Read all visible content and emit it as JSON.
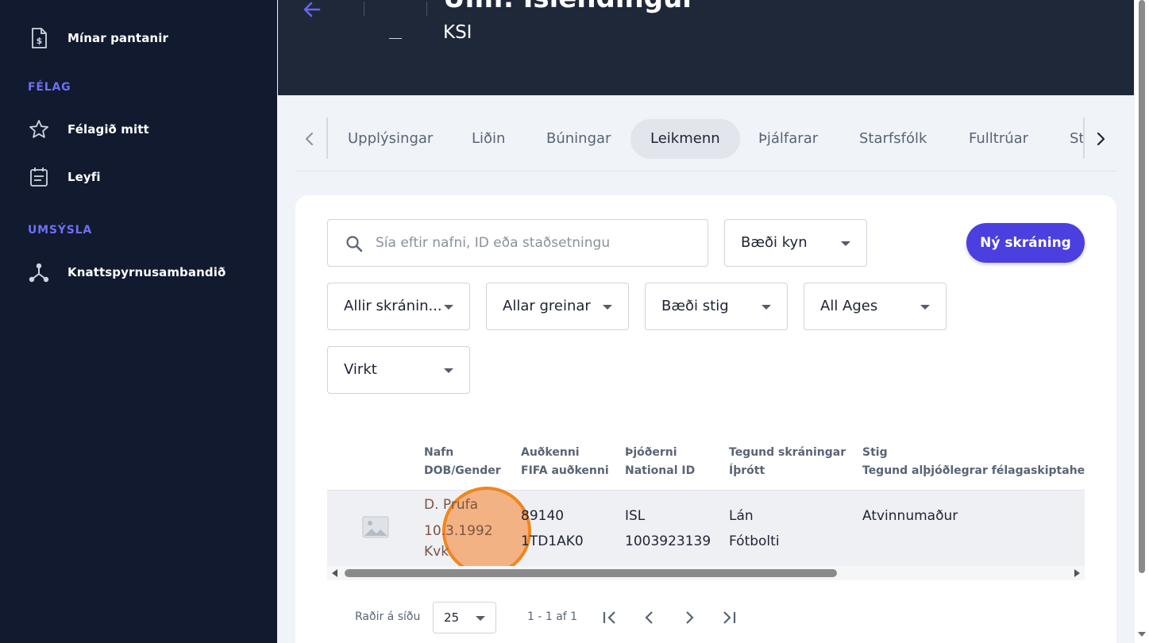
{
  "sidebar": {
    "items": [
      {
        "label": "Mínar pantanir",
        "icon": "invoice-dollar-icon"
      },
      {
        "label": "Félagið mitt",
        "icon": "star-icon"
      },
      {
        "label": "Leyfi",
        "icon": "calendar-list-icon"
      },
      {
        "label": "Knattspyrnusambandið",
        "icon": "hierarchy-icon"
      }
    ],
    "sections": [
      "FÉLAG",
      "UMSÝSLA"
    ]
  },
  "header": {
    "title": "Umf. Íslendingur",
    "subtitle": "KSI"
  },
  "tabs": [
    "Upplýsingar",
    "Liðin",
    "Búningar",
    "Leikmenn",
    "Þjálfarar",
    "Starfsfólk",
    "Fulltrúar",
    "St"
  ],
  "active_tab": "Leikmenn",
  "filters": {
    "search_placeholder": "Sía eftir nafni, ID eða staðsetningu",
    "gender": "Bæði kyn",
    "registration_type": "Allir skránin...",
    "sport": "Allar greinar",
    "level": "Bæði stig",
    "ages": "All Ages",
    "status": "Virkt",
    "new_button": "Ný skráning"
  },
  "table": {
    "headers": [
      {
        "line1": "Nafn",
        "line2": "DOB/Gender"
      },
      {
        "line1": "Auðkenni",
        "line2": "FIFA auðkenni"
      },
      {
        "line1": "Þjóðerni",
        "line2": "National ID"
      },
      {
        "line1": "Tegund skráningar",
        "line2": "Íþrótt"
      },
      {
        "line1": "Stig",
        "line2": "Tegund alþjóðlegrar félagaskiptaheim"
      }
    ],
    "rows": [
      {
        "name": "D. Prufa",
        "dob": "10.3.1992",
        "gender": "Kvk",
        "id": "89140",
        "fifa_id": "1TD1AK0",
        "nationality": "ISL",
        "national_id": "1003923139",
        "reg_type": "Lán",
        "sport": "Fótbolti",
        "level": "Atvinnumaður"
      }
    ]
  },
  "pagination": {
    "rows_label": "Raðir á síðu",
    "rows_per_page": "25",
    "range": "1 - 1 af 1"
  },
  "colors": {
    "sidebar_bg": "#111a2e",
    "header_bg": "#1f2839",
    "accent": "#4b3fe0",
    "section_label": "#6f6ff7",
    "highlight": "#f0861f"
  }
}
